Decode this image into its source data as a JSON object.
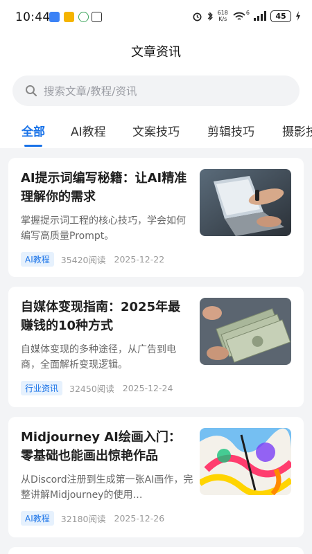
{
  "status": {
    "time": "10:44",
    "net_speed_value": "618",
    "net_speed_unit": "K/s",
    "signal": "6",
    "battery": "45"
  },
  "page": {
    "title": "文章资讯"
  },
  "search": {
    "placeholder": "搜索文章/教程/资讯"
  },
  "tabs": [
    {
      "label": "全部",
      "active": true
    },
    {
      "label": "AI教程"
    },
    {
      "label": "文案技巧"
    },
    {
      "label": "剪辑技巧"
    },
    {
      "label": "摄影技"
    }
  ],
  "articles": [
    {
      "title": "AI提示词编写秘籍：让AI精准理解你的需求",
      "desc": "掌握提示词工程的核心技巧，学会如何编写高质量Prompt。",
      "tag": "AI教程",
      "reads": "35420阅读",
      "date": "2025-12-22",
      "image": "laptop-hands"
    },
    {
      "title": "自媒体变现指南：2025年最赚钱的10种方式",
      "desc": "自媒体变现的多种途径，从广告到电商，全面解析变现逻辑。",
      "tag": "行业资讯",
      "reads": "32450阅读",
      "date": "2025-12-24",
      "image": "cash-money"
    },
    {
      "title": "Midjourney AI绘画入门：零基础也能画出惊艳作品",
      "desc": "从Discord注册到生成第一张AI画作，完整讲解Midjourney的使用…",
      "tag": "AI教程",
      "reads": "32180阅读",
      "date": "2025-12-26",
      "image": "colorful-painting"
    }
  ],
  "colors": {
    "accent": "#1a73e8",
    "tag_bg": "#e6f1fd",
    "page_bg": "#f3f4f6"
  }
}
